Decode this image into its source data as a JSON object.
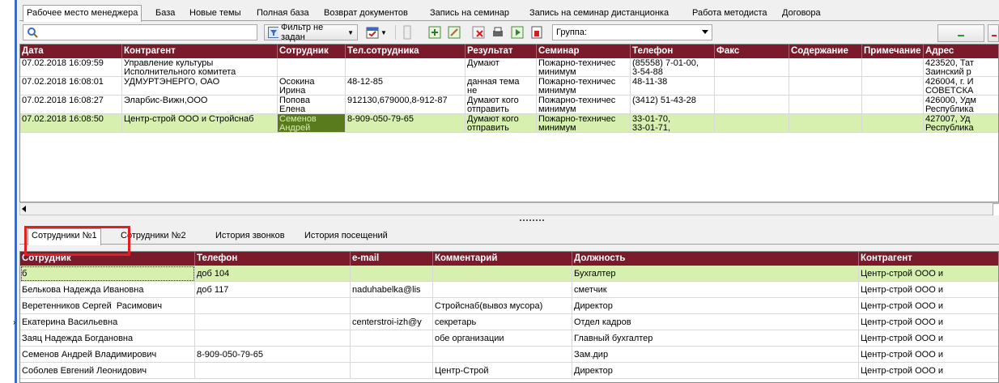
{
  "tabs": [
    {
      "label": "Рабочее место менеджера",
      "active": true
    },
    {
      "label": "База"
    },
    {
      "label": "Новые темы"
    },
    {
      "label": "Полная база"
    },
    {
      "label": "Возврат документов"
    },
    {
      "label": "Запись на семинар"
    },
    {
      "label": "Запись на семинар дистанционка"
    },
    {
      "label": "Работа методиста"
    },
    {
      "label": "Договора"
    }
  ],
  "toolbar": {
    "search_value": "",
    "filter_label": "Фильтр не задан",
    "group_label": "Группа:",
    "icons": [
      "search-icon",
      "filter-icon",
      "calendar-icon",
      "chart-icon",
      "export-icon",
      "edit-icon",
      "delete-icon",
      "print-icon",
      "play-icon",
      "report-icon"
    ]
  },
  "calls": {
    "columns": [
      "Дата",
      "Контрагент",
      "Сотрудник",
      "Тел.сотрудника",
      "Результат",
      "Семинар",
      "Телефон",
      "Факс",
      "Содержание",
      "Примечание",
      "Адрес"
    ],
    "rows": [
      {
        "date": "07.02.2018 16:09:59",
        "contractor": "Управление культуры\nИсполнительного комитета",
        "employee": "",
        "emp_phone": "",
        "result": "Думают",
        "seminar": "Пожарно-техничес\nминимум",
        "phone": "(85558) 7-01-00,\n3-54-88",
        "fax": "",
        "content": "",
        "note": "",
        "address": "423520, Тат\nЗаинский р"
      },
      {
        "date": "07.02.2018 16:08:01",
        "contractor": "УДМУРТЭНЕРГО, ОАО",
        "employee": "Осокина\nИрина",
        "emp_phone": "48-12-85",
        "result": "данная тема\nне",
        "seminar": "Пожарно-техничес\nминимум",
        "phone": "48-11-38",
        "fax": "",
        "content": "",
        "note": "",
        "address": "426004, г. И\nСОВЕТСКА"
      },
      {
        "date": "07.02.2018 16:08:27",
        "contractor": "Эларбис-Вижн,ООО",
        "employee": "Попова\nЕлена",
        "emp_phone": "912130,679000,8-912-87",
        "result": "Думают кого\nотправить",
        "seminar": "Пожарно-техничес\nминимум",
        "phone": "(3412) 51-43-28",
        "fax": "",
        "content": "",
        "note": "",
        "address": "426000, Удм\nРеспублика"
      },
      {
        "date": "07.02.2018 16:08:50",
        "contractor": "Центр-строй ООО и Стройснаб",
        "employee": "Семенов\nАндрей",
        "emp_phone": "8-909-050-79-65",
        "result": "Думают кого\nотправить",
        "seminar": "Пожарно-техничес\nминимум",
        "phone": "33-01-70,\n33-01-71,",
        "fax": "",
        "content": "",
        "note": "",
        "address": "427007, Уд\nРеспублика",
        "selected": true
      }
    ]
  },
  "subtabs": [
    {
      "label": "Сотрудники №1",
      "active": true
    },
    {
      "label": "Сотрудники №2"
    },
    {
      "label": "История звонков"
    },
    {
      "label": "История посещений"
    }
  ],
  "staff": {
    "columns": [
      "Сотрудник",
      "Телефон",
      "e-mail",
      "Комментарий",
      "Должность",
      "Контрагент"
    ],
    "rows": [
      {
        "name": "б",
        "phone": "доб 104",
        "email": "",
        "comment": "",
        "position": "Бухгалтер",
        "contractor": "Центр-строй ООО и",
        "selected": true
      },
      {
        "name": "Белькова Надежда Ивановна",
        "phone": "доб 117",
        "email": "naduhabelka@lis",
        "comment": "",
        "position": "сметчик",
        "contractor": "Центр-строй ООО и"
      },
      {
        "name": "Веретенников Сергей  Расимович",
        "phone": "",
        "email": "",
        "comment": "Стройснаб(вывоз мусора)",
        "position": "Директор",
        "contractor": "Центр-строй ООО и"
      },
      {
        "name": "Екатерина Васильевна",
        "phone": "",
        "email": "centerstroi-izh@y",
        "comment": "секретарь",
        "position": "Отдел кадров",
        "contractor": "Центр-строй ООО и"
      },
      {
        "name": "Заяц Надежда Богдановна",
        "phone": "",
        "email": "",
        "comment": "обе организации",
        "position": "Главный бухгалтер",
        "contractor": "Центр-строй ООО и"
      },
      {
        "name": "Семенов Андрей Владимирович",
        "phone": "8-909-050-79-65",
        "email": "",
        "comment": "",
        "position": "Зам.дир",
        "contractor": "Центр-строй ООО и"
      },
      {
        "name": "Соболев Евгений Леонидович",
        "phone": "",
        "email": "",
        "comment": "Центр-Строй",
        "position": "Директор",
        "contractor": "Центр-строй ООО и"
      }
    ]
  },
  "colors": {
    "header_bg": "#7a1a2a",
    "selected_row": "#d7f0b0",
    "focus_cell": "#5a7a1e",
    "highlight_box": "#e02020"
  }
}
